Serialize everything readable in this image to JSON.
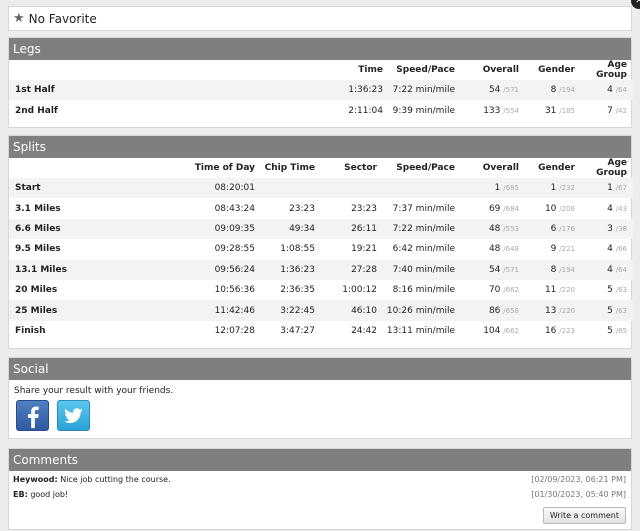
{
  "favorite": {
    "icon": "star-icon",
    "label": "No Favorite"
  },
  "legs": {
    "title": "Legs",
    "columns": [
      "",
      "Time",
      "Speed/Pace",
      "Overall",
      "Gender",
      "Age Group"
    ],
    "rows": [
      {
        "label": "1st Half",
        "time": "1:36:23",
        "pace": "7:22 min/mile",
        "overall": "54",
        "overall_total": "/571",
        "gender": "8",
        "gender_total": "/194",
        "age": "4",
        "age_total": "/64"
      },
      {
        "label": "2nd Half",
        "time": "2:11:04",
        "pace": "9:39 min/mile",
        "overall": "133",
        "overall_total": "/554",
        "gender": "31",
        "gender_total": "/185",
        "age": "7",
        "age_total": "/42"
      }
    ]
  },
  "splits": {
    "title": "Splits",
    "columns": [
      "",
      "Time of Day",
      "Chip Time",
      "Sector",
      "Speed/Pace",
      "Overall",
      "Gender",
      "Age Group"
    ],
    "rows": [
      {
        "label": "Start",
        "tod": "08:20:01",
        "chip": "",
        "sector": "",
        "pace": "",
        "overall": "1",
        "overall_total": "/685",
        "gender": "1",
        "gender_total": "/232",
        "age": "1",
        "age_total": "/67"
      },
      {
        "label": "3.1 Miles",
        "tod": "08:43:24",
        "chip": "23:23",
        "sector": "23:23",
        "pace": "7:37 min/mile",
        "overall": "69",
        "overall_total": "/684",
        "gender": "10",
        "gender_total": "/208",
        "age": "4",
        "age_total": "/43"
      },
      {
        "label": "6.6 Miles",
        "tod": "09:09:35",
        "chip": "49:34",
        "sector": "26:11",
        "pace": "7:22 min/mile",
        "overall": "48",
        "overall_total": "/553",
        "gender": "6",
        "gender_total": "/176",
        "age": "3",
        "age_total": "/38"
      },
      {
        "label": "9.5 Miles",
        "tod": "09:28:55",
        "chip": "1:08:55",
        "sector": "19:21",
        "pace": "6:42 min/mile",
        "overall": "48",
        "overall_total": "/648",
        "gender": "9",
        "gender_total": "/221",
        "age": "4",
        "age_total": "/66"
      },
      {
        "label": "13.1 Miles",
        "tod": "09:56:24",
        "chip": "1:36:23",
        "sector": "27:28",
        "pace": "7:40 min/mile",
        "overall": "54",
        "overall_total": "/571",
        "gender": "8",
        "gender_total": "/194",
        "age": "4",
        "age_total": "/64"
      },
      {
        "label": "20 Miles",
        "tod": "10:56:36",
        "chip": "2:36:35",
        "sector": "1:00:12",
        "pace": "8:16 min/mile",
        "overall": "70",
        "overall_total": "/662",
        "gender": "11",
        "gender_total": "/220",
        "age": "5",
        "age_total": "/63"
      },
      {
        "label": "25 Miles",
        "tod": "11:42:46",
        "chip": "3:22:45",
        "sector": "46:10",
        "pace": "10:26 min/mile",
        "overall": "86",
        "overall_total": "/658",
        "gender": "13",
        "gender_total": "/220",
        "age": "5",
        "age_total": "/63"
      },
      {
        "label": "Finish",
        "tod": "12:07:28",
        "chip": "3:47:27",
        "sector": "24:42",
        "pace": "13:11 min/mile",
        "overall": "104",
        "overall_total": "/662",
        "gender": "16",
        "gender_total": "/223",
        "age": "5",
        "age_total": "/65"
      }
    ]
  },
  "social": {
    "title": "Social",
    "text": "Share your result with your friends.",
    "buttons": [
      {
        "icon": "facebook-icon",
        "color": "#3b5998"
      },
      {
        "icon": "twitter-icon",
        "color": "#3fb3e3"
      }
    ]
  },
  "comments": {
    "title": "Comments",
    "items": [
      {
        "author": "Heywood:",
        "text": "Nice job cutting the course.",
        "date": "[02/09/2023, 06:21 PM]"
      },
      {
        "author": "EB:",
        "text": "good job!",
        "date": "[01/30/2023, 05:40 PM]"
      }
    ],
    "write_label": "Write a comment"
  },
  "colors": {
    "header_bg": "#7f7f7f",
    "row_alt": "#f3f3f3"
  }
}
